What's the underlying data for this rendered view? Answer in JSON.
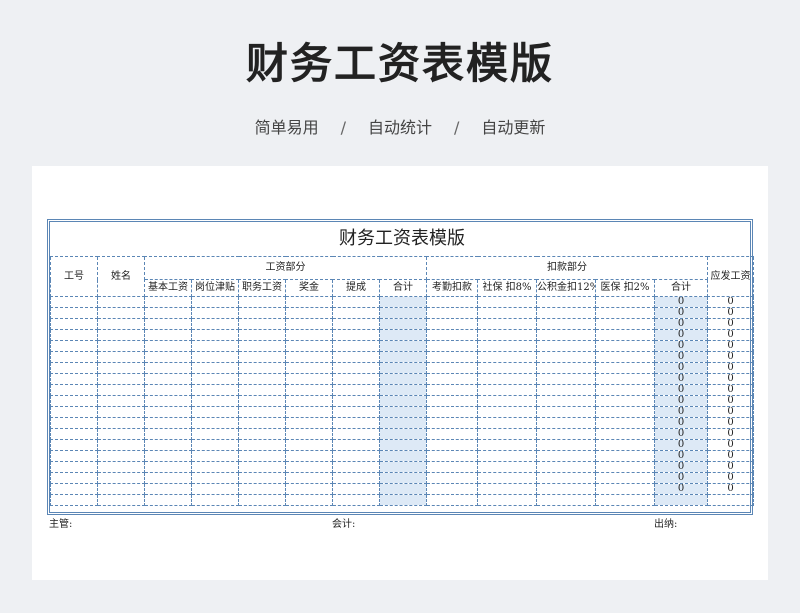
{
  "page": {
    "hero_title": "财务工资表模版",
    "subtitle": [
      "简单易用",
      "自动统计",
      "自动更新"
    ],
    "subtitle_separator": "/"
  },
  "sheet": {
    "title": "财务工资表模版",
    "headers": {
      "id": "工号",
      "name": "姓名",
      "salary_group": "工资部分",
      "deduction_group": "扣款部分",
      "payable": "应发工资",
      "salary_cols": [
        "基本工资",
        "岗位津贴",
        "职务工资",
        "奖金",
        "提成",
        "合计"
      ],
      "deduction_cols": [
        "考勤扣款",
        "社保 扣8%",
        "公积金扣12%",
        "医保 扣2%",
        "合计"
      ]
    },
    "rows": [
      {
        "ded_total": "0",
        "payable": "0"
      },
      {
        "ded_total": "0",
        "payable": "0"
      },
      {
        "ded_total": "0",
        "payable": "0"
      },
      {
        "ded_total": "0",
        "payable": "0"
      },
      {
        "ded_total": "0",
        "payable": "0"
      },
      {
        "ded_total": "0",
        "payable": "0"
      },
      {
        "ded_total": "0",
        "payable": "0"
      },
      {
        "ded_total": "0",
        "payable": "0"
      },
      {
        "ded_total": "0",
        "payable": "0"
      },
      {
        "ded_total": "0",
        "payable": "0"
      },
      {
        "ded_total": "0",
        "payable": "0"
      },
      {
        "ded_total": "0",
        "payable": "0"
      },
      {
        "ded_total": "0",
        "payable": "0"
      },
      {
        "ded_total": "0",
        "payable": "0"
      },
      {
        "ded_total": "0",
        "payable": "0"
      },
      {
        "ded_total": "0",
        "payable": "0"
      },
      {
        "ded_total": "0",
        "payable": "0"
      },
      {
        "ded_total": "0",
        "payable": "0"
      }
    ],
    "footer": {
      "supervisor": "主管:",
      "accountant": "会计:",
      "cashier": "出纳:"
    },
    "colors": {
      "border": "#5b86b5",
      "highlight": "#dde9f6"
    }
  }
}
